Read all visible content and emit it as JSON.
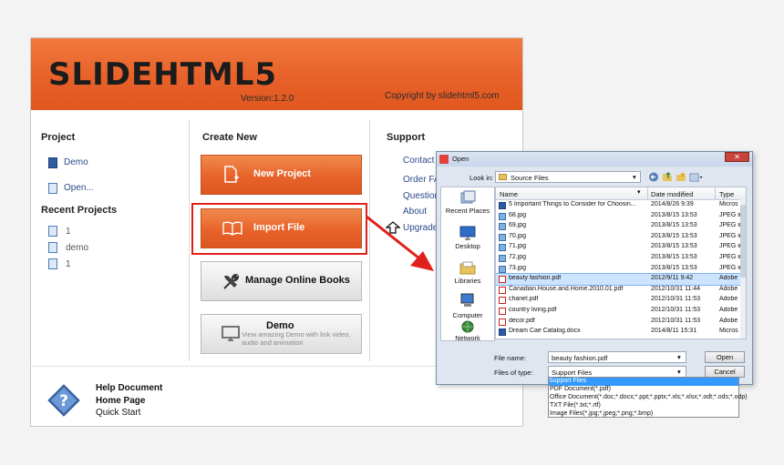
{
  "app": {
    "title": "SLIDEHTML5",
    "version": "Version:1.2.0",
    "copyright": "Copyright by slidehtml5.com"
  },
  "project": {
    "heading": "Project",
    "items": [
      "Demo",
      "Open..."
    ]
  },
  "recent": {
    "heading": "Recent Projects",
    "items": [
      "1",
      "demo",
      "1"
    ]
  },
  "create": {
    "heading": "Create New",
    "new_project": "New Project",
    "import_file": "Import File",
    "manage": "Manage Online Books",
    "demo_title": "Demo",
    "demo_desc": "View amazing Demo with link video, audio and animation"
  },
  "support": {
    "heading": "Support",
    "items": [
      "Contact",
      "Order FA",
      "Question",
      "About",
      "Upgrade"
    ]
  },
  "footer": {
    "items": [
      "Help Document",
      "Home Page",
      "Quick Start"
    ]
  },
  "dialog": {
    "title": "Open",
    "look_in_label": "Look in:",
    "look_in_value": "Source Files",
    "places": [
      "Recent Places",
      "Desktop",
      "Libraries",
      "Computer",
      "Network"
    ],
    "columns": [
      "Name",
      "Date modified",
      "Type"
    ],
    "files": [
      {
        "name": "5 Important Things to Consider for Choosin...",
        "date": "2014/8/26 9:39",
        "type": "Micros",
        "kind": "doc"
      },
      {
        "name": "68.jpg",
        "date": "2013/8/15 13:53",
        "type": "JPEG ir",
        "kind": "img"
      },
      {
        "name": "69.jpg",
        "date": "2013/8/15 13:53",
        "type": "JPEG ir",
        "kind": "img"
      },
      {
        "name": "70.jpg",
        "date": "2013/8/15 13:53",
        "type": "JPEG ir",
        "kind": "img"
      },
      {
        "name": "71.jpg",
        "date": "2013/8/15 13:53",
        "type": "JPEG ir",
        "kind": "img"
      },
      {
        "name": "72.jpg",
        "date": "2013/8/15 13:53",
        "type": "JPEG ir",
        "kind": "img"
      },
      {
        "name": "73.jpg",
        "date": "2013/8/15 13:53",
        "type": "JPEG ir",
        "kind": "img"
      },
      {
        "name": "beauty fashion.pdf",
        "date": "2012/9/11 9:42",
        "type": "Adobe",
        "kind": "pdf",
        "selected": true
      },
      {
        "name": "Canadian.House.and.Home.2010.01.pdf",
        "date": "2012/10/31 11:44",
        "type": "Adobe",
        "kind": "pdf"
      },
      {
        "name": "chanel.pdf",
        "date": "2012/10/31 11:53",
        "type": "Adobe",
        "kind": "pdf"
      },
      {
        "name": "country living.pdf",
        "date": "2012/10/31 11:53",
        "type": "Adobe",
        "kind": "pdf"
      },
      {
        "name": "decor.pdf",
        "date": "2012/10/31 11:53",
        "type": "Adobe",
        "kind": "pdf"
      },
      {
        "name": "Dream Cae Catalog.docx",
        "date": "2014/8/11 15:31",
        "type": "Micros",
        "kind": "doc"
      }
    ],
    "file_name_label": "File name:",
    "file_name_value": "beauty fashion.pdf",
    "file_type_label": "Files of type:",
    "file_type_value": "Support Files",
    "open_label": "Open",
    "cancel_label": "Cancel",
    "type_options": [
      "Support Files",
      "PDF Document(*.pdf)",
      "Office Document(*.doc;*.docx;*.ppt;*.pptx;*.xls;*.xlsx;*.odt;*.ods;*.odp)",
      "TXT File(*.txt;*.rtf)",
      "Image Files(*.jpg;*.jpeg;*.png;*.bmp)"
    ]
  },
  "colors": {
    "orange": "#e8632b",
    "highlight_red": "#e0201c",
    "selection": "#3399ff"
  }
}
